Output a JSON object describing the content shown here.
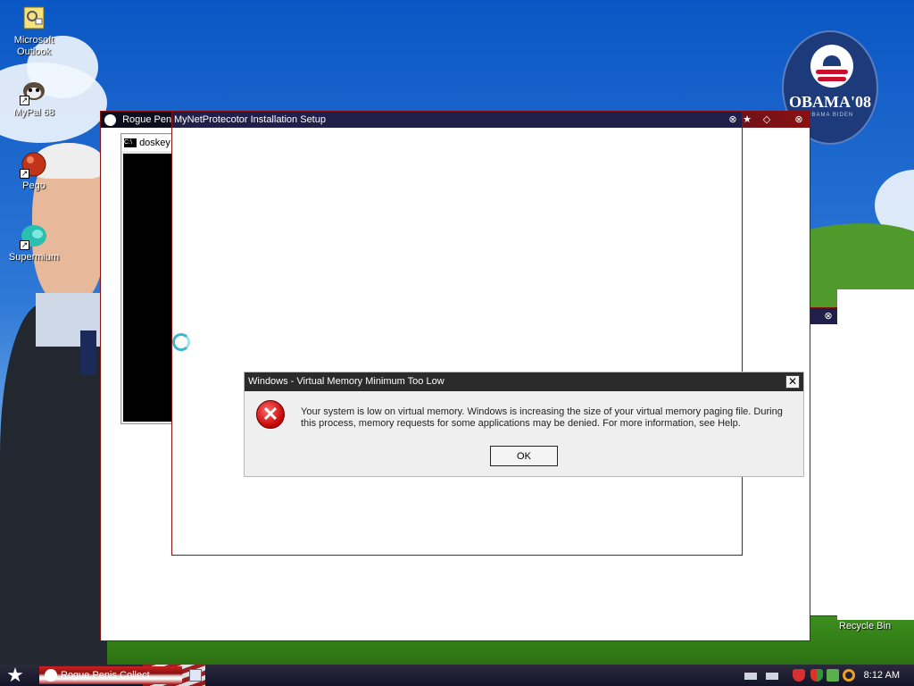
{
  "desktop": {
    "icons": [
      {
        "label": "Microsoft Outlook",
        "icon": "outlook-icon"
      },
      {
        "label": "MyPal 68",
        "icon": "mypal-icon"
      },
      {
        "label": "Pego",
        "icon": "pego-icon"
      },
      {
        "label": "Supermium",
        "icon": "supermium-icon"
      }
    ],
    "recycle_bin": "Recycle Bin",
    "badge": {
      "text": "OBAMA'08",
      "small": "OBAMA BIDEN"
    }
  },
  "windows": {
    "rogue": {
      "title": "Rogue Penis"
    },
    "doskey": {
      "title": "doskey"
    },
    "setup": {
      "title": "MyNetProtecotor Installation Setup"
    }
  },
  "dialog": {
    "title": "Windows - Virtual Memory Minimum Too Low",
    "message": "Your system is low on virtual memory. Windows is increasing the size of your virtual memory paging file. During this process, memory requests for some applications may be denied. For more information, see Help.",
    "ok_label": "OK",
    "close_label": "✕"
  },
  "taskbar": {
    "task_label": "Rogue Penis Collect...",
    "clock": "8:12 AM"
  },
  "colors": {
    "dialog_titlebar": "#2b2b2b",
    "window_titlebar": "#1f1f4a",
    "accent_red": "#8a1010"
  }
}
